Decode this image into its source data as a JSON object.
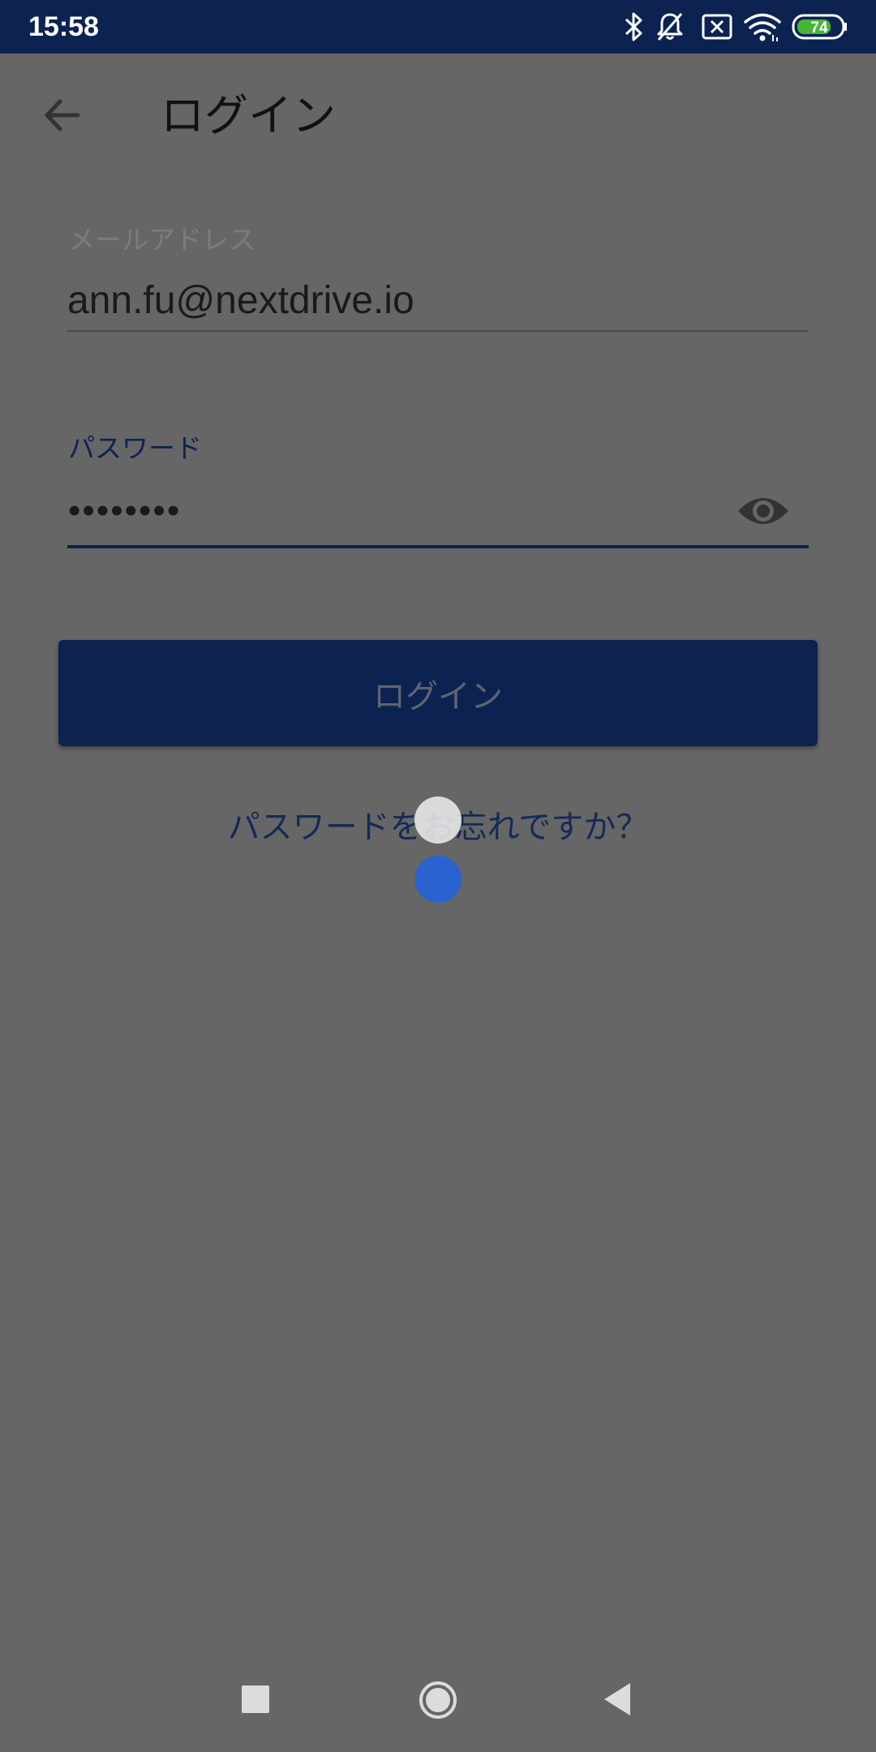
{
  "status_bar": {
    "time": "15:58",
    "battery_level": "74",
    "icons": [
      "bluetooth-icon",
      "bell-off-icon",
      "sim-off-icon",
      "wifi-icon",
      "battery-icon"
    ]
  },
  "app_bar": {
    "back_icon": "arrow-back-icon",
    "title": "ログイン"
  },
  "form": {
    "email_label": "メールアドレス",
    "email_value": "ann.fu@nextdrive.io",
    "password_label": "パスワード",
    "password_value": "••••••••",
    "password_toggle_icon": "eye-icon"
  },
  "actions": {
    "login_button": "ログイン",
    "forgot_password": "パスワードをお忘れですか？"
  },
  "nav_bar": {
    "icons": [
      "recents-square-icon",
      "home-circle-icon",
      "back-triangle-icon"
    ]
  },
  "colors": {
    "primary": "#0c2351",
    "scrim_background": "#666666",
    "touch_indicator": "#2a62d0"
  }
}
